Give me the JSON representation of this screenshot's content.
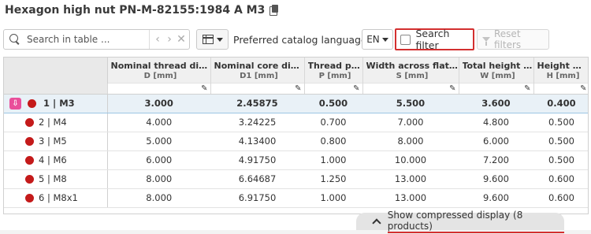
{
  "header": {
    "title": "Hexagon high nut PN-M-82155:1984 A M3",
    "copy_icon": "copy-icon"
  },
  "toolbar": {
    "search_placeholder": "Search in table ...",
    "search_nav": [
      "‹",
      "›",
      "✕"
    ],
    "language_label": "Preferred catalog language",
    "language_value": "EN",
    "search_filter_label": "Search filter",
    "reset_filters_label": "Reset filters"
  },
  "table": {
    "columns": [
      {
        "name": "Nominal thread diam...",
        "unit": "D [mm]"
      },
      {
        "name": "Nominal core diam...",
        "unit": "D1 [mm]"
      },
      {
        "name": "Thread pitch",
        "unit": "P [mm]"
      },
      {
        "name": "Width across flats ...",
        "unit": "S [mm]"
      },
      {
        "name": "Total height m...",
        "unit": "W [mm]"
      },
      {
        "name": "Height max.",
        "unit": "H [mm]"
      }
    ],
    "rows": [
      {
        "label": "1 | M3",
        "values": [
          "3.000",
          "2.45875",
          "0.500",
          "5.500",
          "3.600",
          "0.400"
        ],
        "selected": true
      },
      {
        "label": "2 | M4",
        "values": [
          "4.000",
          "3.24225",
          "0.700",
          "7.000",
          "4.800",
          "0.500"
        ]
      },
      {
        "label": "3 | M5",
        "values": [
          "5.000",
          "4.13400",
          "0.800",
          "8.000",
          "6.000",
          "0.500"
        ]
      },
      {
        "label": "4 | M6",
        "values": [
          "6.000",
          "4.91750",
          "1.000",
          "10.000",
          "7.200",
          "0.500"
        ]
      },
      {
        "label": "5 | M8",
        "values": [
          "8.000",
          "6.64687",
          "1.250",
          "13.000",
          "9.600",
          "0.600"
        ]
      },
      {
        "label": "6 | M8x1",
        "values": [
          "8.000",
          "6.91750",
          "1.000",
          "13.000",
          "9.600",
          "0.600"
        ]
      }
    ],
    "status_color": "#c41a1a",
    "download_color": "#e94f9a",
    "selected_bg": "#e9f1f7"
  },
  "footer": {
    "compress_label": "Show compressed display (8 products)"
  },
  "colors": {
    "highlight_red": "#d32f2f"
  }
}
